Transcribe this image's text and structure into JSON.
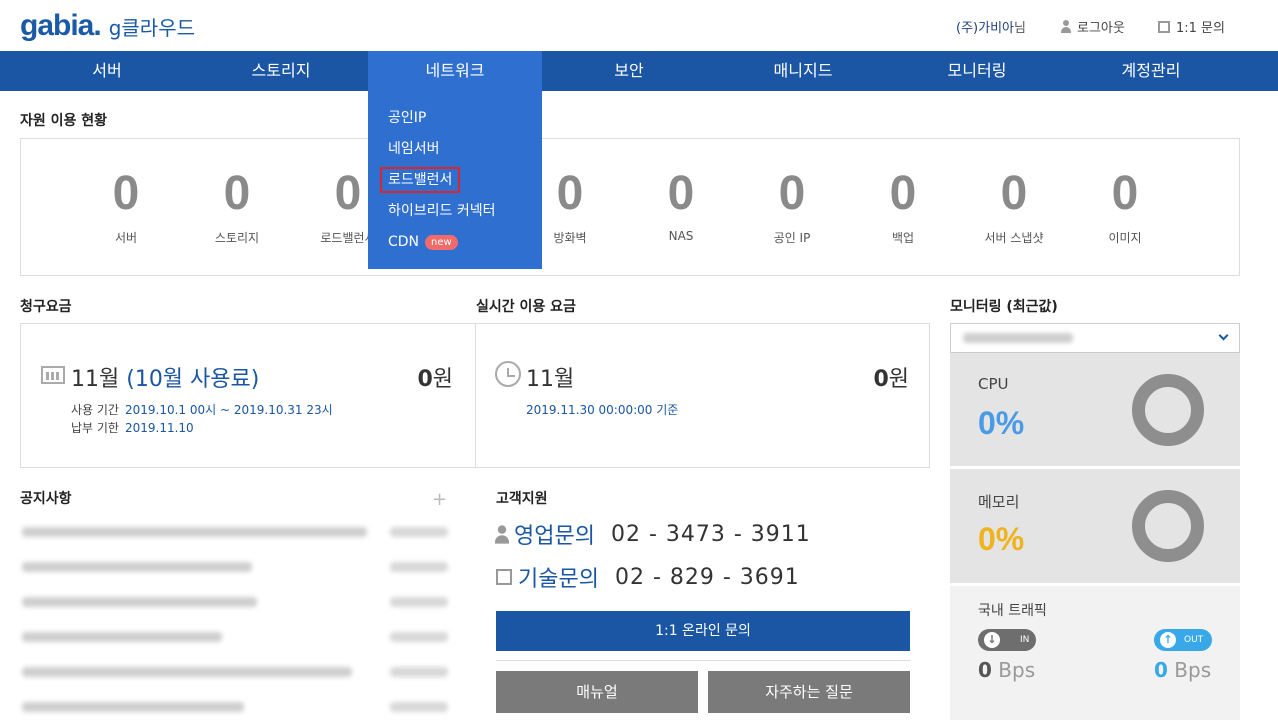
{
  "header": {
    "logo_text": "gabia.",
    "logo_sub": "g클라우드",
    "user_company": "(주)가비아",
    "user_suffix": "님",
    "logout": "로그아웃",
    "inquiry": "1:1 문의"
  },
  "nav": {
    "items": [
      "서버",
      "스토리지",
      "네트워크",
      "보안",
      "매니지드",
      "모니터링",
      "계정관리"
    ],
    "active": "네트워크",
    "dropdown": [
      {
        "label": "공인IP"
      },
      {
        "label": "네임서버"
      },
      {
        "label": "로드밸런서",
        "highlighted": true
      },
      {
        "label": "하이브리드 커넥터"
      },
      {
        "label": "CDN",
        "badge": "new"
      }
    ]
  },
  "resources": {
    "title": "자원 이용 현황",
    "items": [
      {
        "value": "0",
        "label": "서버"
      },
      {
        "value": "0",
        "label": "스토리지"
      },
      {
        "value": "0",
        "label": "로드밸런서"
      },
      {
        "value": "0",
        "label": "방화벽"
      },
      {
        "value": "0",
        "label": "NAS"
      },
      {
        "value": "0",
        "label": "공인 IP"
      },
      {
        "value": "0",
        "label": "백업"
      },
      {
        "value": "0",
        "label": "서버 스냅샷"
      },
      {
        "value": "0",
        "label": "이미지"
      }
    ]
  },
  "billing": {
    "title": "청구요금",
    "month": "11월",
    "usage_month": "(10월 사용료)",
    "amount": "0",
    "unit": "원",
    "period_label": "사용 기간",
    "period_value": "2019.10.1 00시 ~ 2019.10.31 23시",
    "due_label": "납부 기한",
    "due_value": "2019.11.10"
  },
  "realtime": {
    "title": "실시간 이용 요금",
    "month": "11월",
    "amount": "0",
    "unit": "원",
    "basis": "2019.11.30 00:00:00 기준"
  },
  "monitoring": {
    "title": "모니터링 (최근값)",
    "cpu_label": "CPU",
    "cpu_value": "0%",
    "cpu_color": "#4a9be6",
    "mem_label": "메모리",
    "mem_value": "0%",
    "mem_color": "#f0b31e",
    "traffic_label": "국내 트래픽",
    "in_label": "IN",
    "out_label": "OUT",
    "in_value": "0",
    "out_value": "0",
    "unit": "Bps",
    "in_color": "#6e6e6e",
    "out_color": "#39a8e8"
  },
  "notices": {
    "title": "공지사항",
    "plus": "+"
  },
  "support": {
    "title": "고객지원",
    "sales_label": "영업문의",
    "sales_phone": "02 - 3473 - 3911",
    "tech_label": "기술문의",
    "tech_phone": "02 - 829 - 3691",
    "online_button": "1:1 온라인 문의",
    "manual_button": "매뉴얼",
    "faq_button": "자주하는 질문"
  },
  "colors": {
    "brand": "#1a56a3",
    "nav_active": "#2f6fd0",
    "highlight": "#d9262a"
  }
}
